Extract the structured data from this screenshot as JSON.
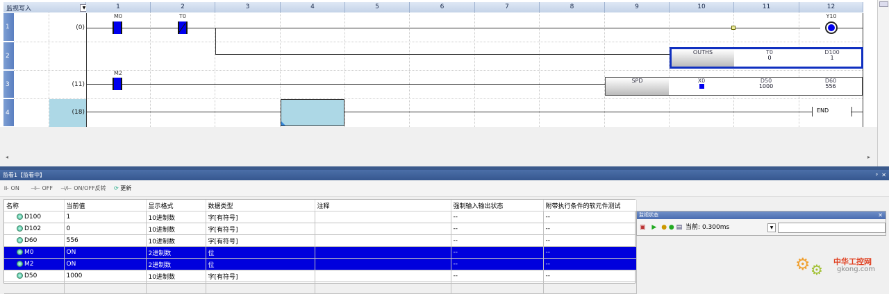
{
  "ladder": {
    "mode_label": "监视写入",
    "columns": [
      "1",
      "2",
      "3",
      "4",
      "5",
      "6",
      "7",
      "8",
      "9",
      "10",
      "11",
      "12"
    ],
    "rows": [
      "1",
      "2",
      "3",
      "4"
    ],
    "steps": [
      "(0)",
      "(11)",
      "(18)"
    ],
    "devices": {
      "m0": "M0",
      "t0": "T0",
      "m2": "M2",
      "y10": "Y10"
    },
    "ouths": {
      "name": "OUTHS",
      "op1_name": "T0",
      "op1_val": "0",
      "op2_name": "D100",
      "op2_val": "1"
    },
    "spd": {
      "name": "SPD",
      "op1_name": "X0",
      "op2_name": "D50",
      "op2_val": "1000",
      "op3_name": "D60",
      "op3_val": "556"
    },
    "end_label": "END"
  },
  "monitor": {
    "title": "监看1【监看中】",
    "toolbar": {
      "on": "ON",
      "off": "OFF",
      "toggle": "ON/OFF反转",
      "update": "更新"
    },
    "headers": [
      "名称",
      "当前值",
      "显示格式",
      "数据类型",
      "注释",
      "强制输入输出状态",
      "附带执行条件的软元件测试"
    ],
    "rows": [
      {
        "name": "D100",
        "value": "1",
        "format": "10进制数",
        "type": "字[有符号]",
        "comment": "",
        "force": "--",
        "test": "--",
        "selected": false
      },
      {
        "name": "D102",
        "value": "0",
        "format": "10进制数",
        "type": "字[有符号]",
        "comment": "",
        "force": "--",
        "test": "--",
        "selected": false
      },
      {
        "name": "D60",
        "value": "556",
        "format": "10进制数",
        "type": "字[有符号]",
        "comment": "",
        "force": "--",
        "test": "--",
        "selected": false
      },
      {
        "name": "M0",
        "value": "ON",
        "format": "2进制数",
        "type": "位",
        "comment": "",
        "force": "--",
        "test": "--",
        "selected": true
      },
      {
        "name": "M2",
        "value": "ON",
        "format": "2进制数",
        "type": "位",
        "comment": "",
        "force": "--",
        "test": "--",
        "selected": true
      },
      {
        "name": "D50",
        "value": "1000",
        "format": "10进制数",
        "type": "字[有符号]",
        "comment": "",
        "force": "--",
        "test": "--",
        "selected": false
      }
    ],
    "status": {
      "title": "监视状态",
      "current": "当前: 0.300ms"
    }
  },
  "watermark": {
    "text": "中华工控网",
    "url": "gkong.com"
  },
  "colors": {
    "contact": "#0000ee",
    "selected_row": "#0000dd",
    "header_blue": "#4b6fa8"
  }
}
